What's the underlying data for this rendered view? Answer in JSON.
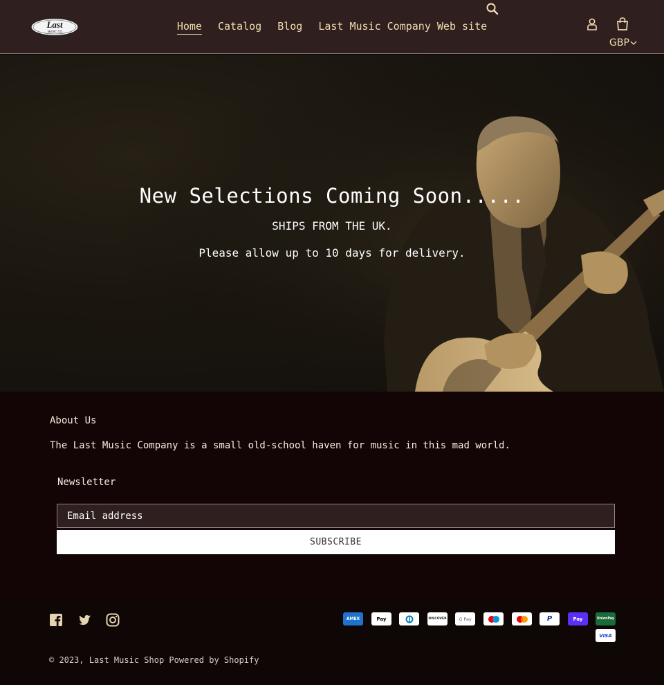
{
  "header": {
    "logo_text": "Last",
    "logo_subtext": "MUSIC CO.",
    "nav": [
      {
        "label": "Home"
      },
      {
        "label": "Catalog"
      },
      {
        "label": "Blog"
      },
      {
        "label": "Last Music Company Web site"
      }
    ],
    "currency": "GBP",
    "icons": [
      "search-icon",
      "account-icon",
      "cart-icon",
      "chevron-down-icon"
    ]
  },
  "hero": {
    "title": "New Selections Coming Soon.....",
    "subtitle": "SHIPS FROM THE UK.",
    "note": "Please allow up to 10 days for delivery."
  },
  "footer": {
    "about_heading": "About Us",
    "about_text": "The Last Music Company is a small old-school haven for music in this mad world.",
    "newsletter_heading": "Newsletter",
    "email_placeholder": "Email address",
    "subscribe_label": "SUBSCRIBE",
    "social": [
      "facebook-icon",
      "twitter-icon",
      "instagram-icon"
    ],
    "payments": [
      {
        "name": "American Express",
        "label": "AMEX"
      },
      {
        "name": "Apple Pay",
        "label": "Pay"
      },
      {
        "name": "Diners Club",
        "label": "D"
      },
      {
        "name": "Discover",
        "label": "DISCOVER"
      },
      {
        "name": "Google Pay",
        "label": "G Pay"
      },
      {
        "name": "Maestro",
        "label": ""
      },
      {
        "name": "Mastercard",
        "label": ""
      },
      {
        "name": "PayPal",
        "label": "P"
      },
      {
        "name": "Shop Pay",
        "label": "Pay"
      },
      {
        "name": "Union Pay",
        "label": "UnionPay"
      },
      {
        "name": "Visa",
        "label": "VISA"
      }
    ],
    "copyright_prefix": "© 2023,",
    "shop_name": "Last Music Shop",
    "powered_by": "Powered by Shopify"
  },
  "colors": {
    "header_bg": "#301f1f",
    "footer_bg": "#130505",
    "nav_text": "#f1dfb0",
    "hero_tint": "#c9a873"
  }
}
